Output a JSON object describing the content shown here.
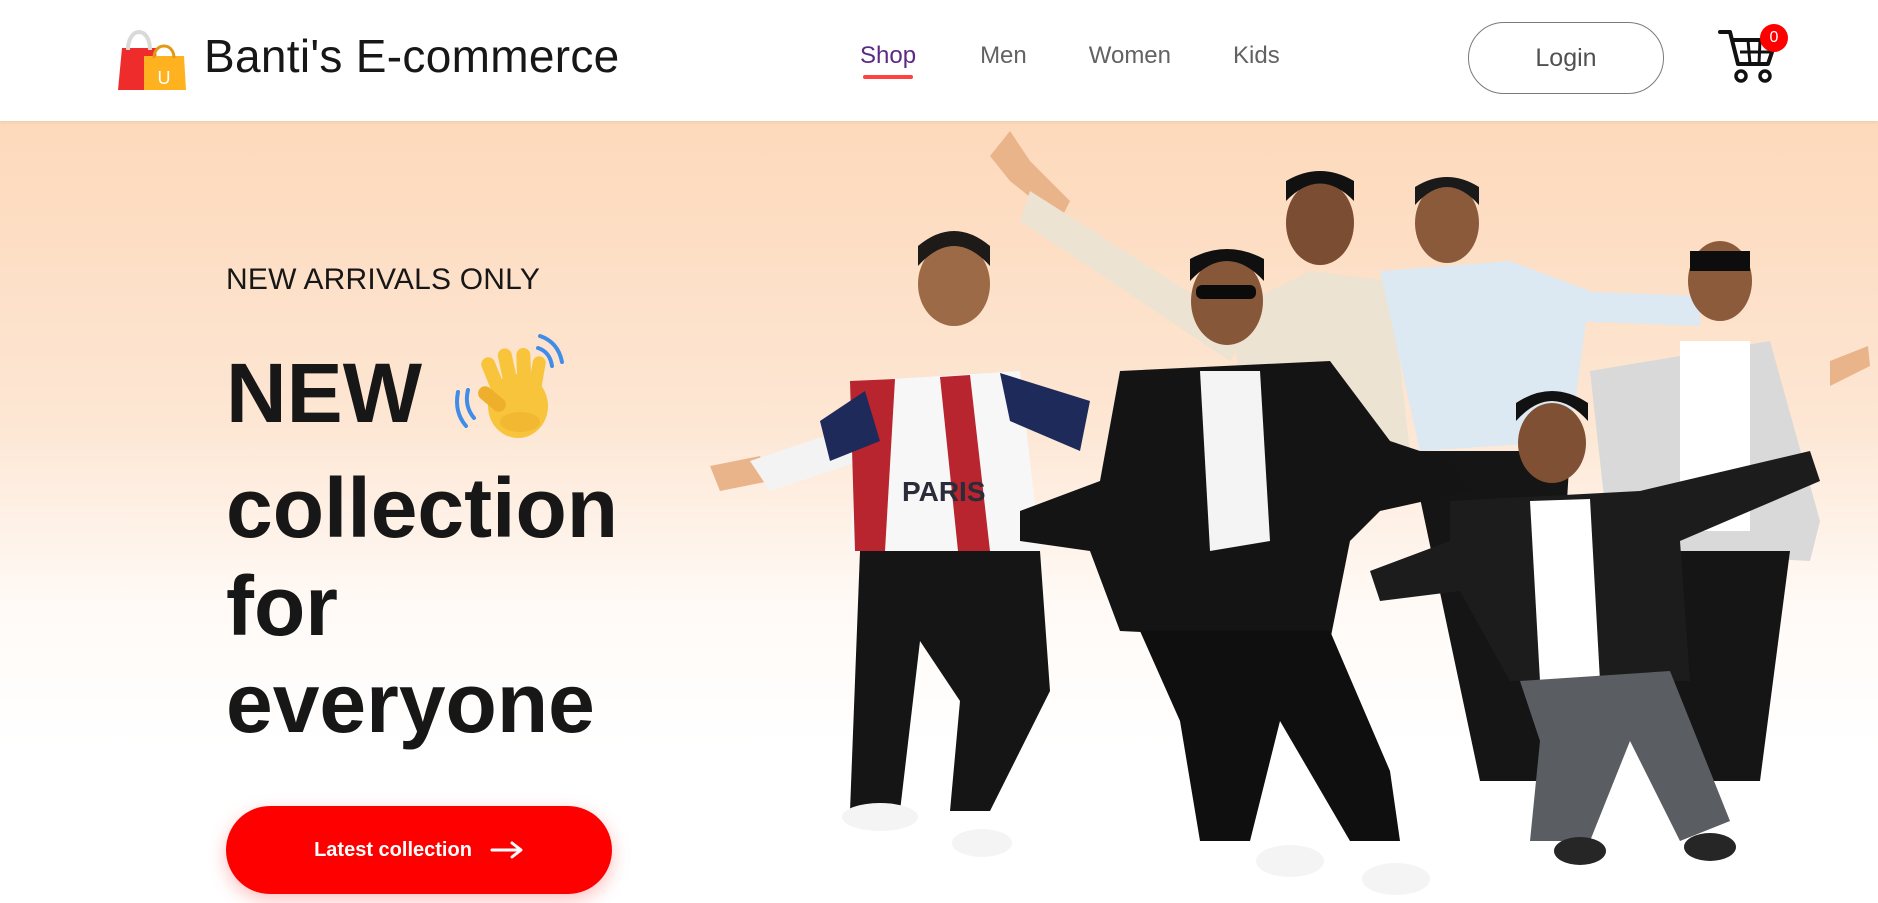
{
  "brand": {
    "name": "Banti's E-commerce",
    "logo_icon": "shopping-bag-icon",
    "logo_letter": "U"
  },
  "nav": {
    "items": [
      {
        "label": "Shop",
        "active": true
      },
      {
        "label": "Men",
        "active": false
      },
      {
        "label": "Women",
        "active": false
      },
      {
        "label": "Kids",
        "active": false
      }
    ]
  },
  "header": {
    "login_label": "Login",
    "cart_icon": "cart-icon",
    "cart_count": "0"
  },
  "hero": {
    "eyebrow": "NEW ARRIVALS ONLY",
    "line1": "NEW",
    "line2": "collection",
    "line3": "for",
    "line4": "everyone",
    "wave_icon": "waving-hand-icon",
    "cta_label": "Latest collection",
    "cta_icon": "arrow-right-icon",
    "photo_text": "PARIS"
  },
  "colors": {
    "accent": "#ff0000",
    "active_nav": "#5b2a86",
    "underline": "#ff4141",
    "hero_gradient_top": "#fdd9bb"
  }
}
